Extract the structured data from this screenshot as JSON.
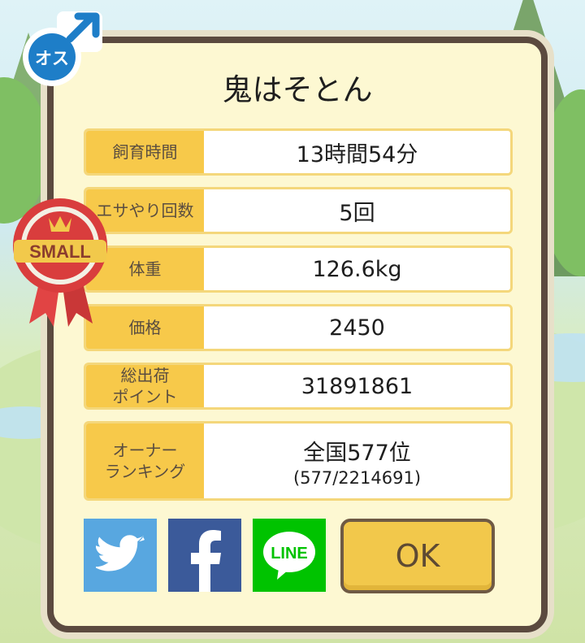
{
  "gender_badge": {
    "label": "オス"
  },
  "rank_badge": {
    "label": "SMALL"
  },
  "card": {
    "name": "鬼はそとん",
    "rows": [
      {
        "label": "飼育時間",
        "value": "13時間54分"
      },
      {
        "label": "エサやり回数",
        "value": "5回"
      },
      {
        "label": "体重",
        "value": "126.6kg"
      },
      {
        "label": "価格",
        "value": "2450"
      },
      {
        "label_line1": "総出荷",
        "label_line2": "ポイント",
        "value": "31891861"
      },
      {
        "label_line1": "オーナー",
        "label_line2": "ランキング",
        "value": "全国577位",
        "sub": "(577/2214691)"
      }
    ]
  },
  "share": {
    "twitter_icon": "twitter-bird",
    "facebook_icon": "f",
    "line_label": "LINE"
  },
  "ok_label": "OK",
  "colors": {
    "panel_bg": "#fdf8d2",
    "panel_border": "#5b4a3f",
    "label_bg": "#f7c94a",
    "ok_bg": "#f2c84b",
    "twitter": "#58a7e0",
    "facebook": "#3b5a9a",
    "line": "#00c300"
  }
}
